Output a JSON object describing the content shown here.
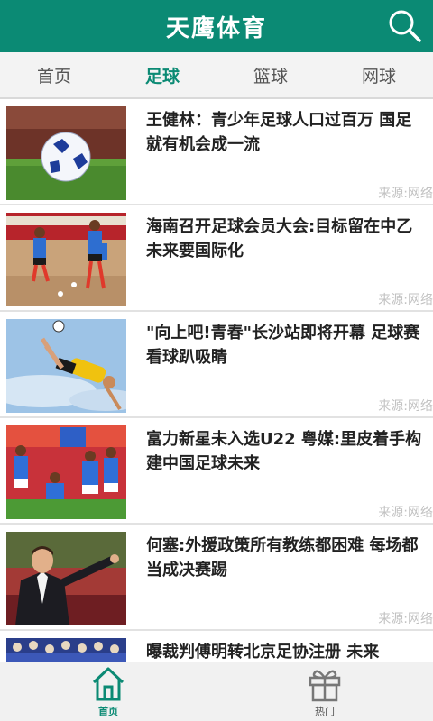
{
  "header": {
    "title": "天鹰体育",
    "search_icon": "search-icon"
  },
  "tabs": [
    {
      "label": "首页",
      "active": false
    },
    {
      "label": "足球",
      "active": true
    },
    {
      "label": "篮球",
      "active": false
    },
    {
      "label": "网球",
      "active": false
    }
  ],
  "articles": [
    {
      "title": "王健林：青少年足球人口过百万 国足就有机会成一流",
      "source": "来源:网络",
      "thumb": "soccer-ball-photo"
    },
    {
      "title": "海南召开足球会员大会:目标留在中乙 未来要国际化",
      "source": "来源:网络",
      "thumb": "training-photo"
    },
    {
      "title": "\"向上吧!青春\"长沙站即将开幕 足球赛看球趴吸睛",
      "source": "来源:网络",
      "thumb": "bicycle-kick-photo"
    },
    {
      "title": "富力新星未入选U22 粤媒:里皮着手构建中国足球未来",
      "source": "来源:网络",
      "thumb": "team-players-photo"
    },
    {
      "title": "何塞:外援政策所有教练都困难 每场都当成决赛踢",
      "source": "来源:网络",
      "thumb": "coach-photo"
    },
    {
      "title": "曝裁判傅明转北京足协注册 未来",
      "source": "",
      "thumb": "crowd-photo"
    }
  ],
  "bottom_nav": [
    {
      "label": "首页",
      "icon": "home-icon",
      "active": true
    },
    {
      "label": "热门",
      "icon": "gift-icon",
      "active": false
    }
  ],
  "colors": {
    "brand": "#0b8a74",
    "tab_bar": "#f3f3f3",
    "source_text": "#c2c2c2"
  }
}
